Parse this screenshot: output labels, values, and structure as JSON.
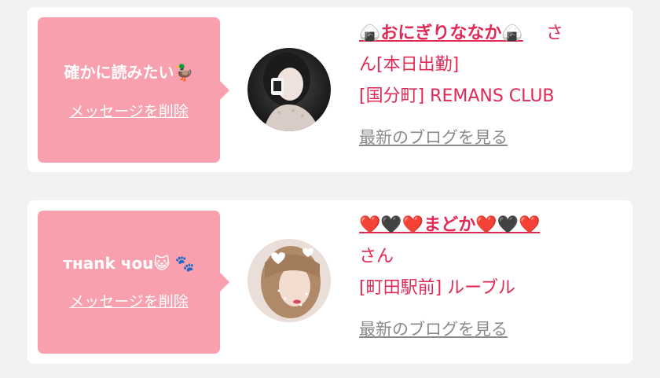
{
  "messages": [
    {
      "text": "確かに読みたい",
      "text_emoji": "🦆",
      "delete_label": "メッセージを削除",
      "cast": {
        "name_prefix": "🍙",
        "name": "おにぎりななか",
        "name_suffix": "🍙",
        "honorific": "さ",
        "honorific_cont": "ん",
        "status": "[本日出勤]",
        "area": "[国分町]",
        "shop": "REMANS CLUB"
      },
      "blog_label": "最新のブログを見る"
    },
    {
      "text": "тнank чou",
      "text_emoji": "😺 🐾",
      "delete_label": "メッセージを削除",
      "cast": {
        "name_prefix": "❤️🖤❤️",
        "name": "まどか",
        "name_suffix": "❤️🖤❤️",
        "honorific": "さん",
        "area": "[町田駅前]",
        "shop": "ルーブル"
      },
      "blog_label": "最新のブログを見る"
    }
  ],
  "colors": {
    "background": "#f2f2f2",
    "bubble": "#f8a0ae",
    "accent": "#e02a55",
    "link_gray": "#8a8a8a"
  }
}
